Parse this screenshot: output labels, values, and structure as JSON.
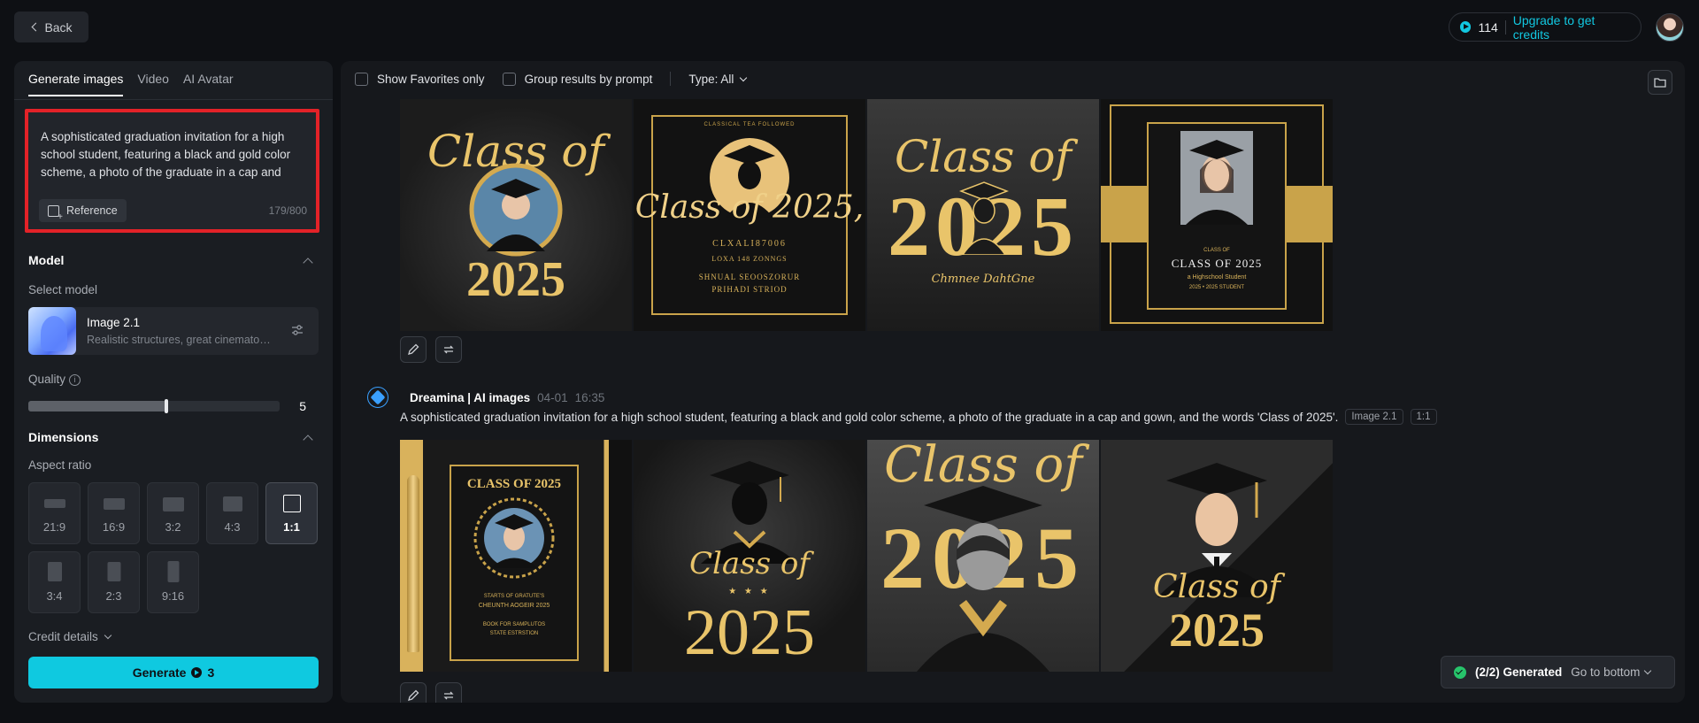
{
  "topbar": {
    "back_label": "Back",
    "credits": "114",
    "upgrade_label": "Upgrade to get credits"
  },
  "left": {
    "tabs": [
      {
        "label": "Generate images"
      },
      {
        "label": "Video"
      },
      {
        "label": "AI Avatar"
      }
    ],
    "prompt": "A sophisticated graduation invitation for a high school student, featuring a black and gold color scheme, a photo of the graduate in a cap and gown, and the words 'Class of 2025'.",
    "reference_label": "Reference",
    "char_count": "179/800",
    "model_section": "Model",
    "select_model_label": "Select model",
    "model_name": "Image 2.1",
    "model_desc": "Realistic structures, great cinematography",
    "quality_label": "Quality",
    "quality_value": "5",
    "quality_fraction": 0.55,
    "dimensions_section": "Dimensions",
    "aspect_label": "Aspect ratio",
    "ratios": [
      {
        "label": "21:9"
      },
      {
        "label": "16:9"
      },
      {
        "label": "3:2"
      },
      {
        "label": "4:3"
      },
      {
        "label": "1:1"
      },
      {
        "label": "3:4"
      },
      {
        "label": "2:3"
      },
      {
        "label": "9:16"
      }
    ],
    "selected_ratio": "1:1",
    "credit_details_label": "Credit details",
    "generate_label": "Generate",
    "generate_cost": "3"
  },
  "main": {
    "filters": {
      "favorites_label": "Show Favorites only",
      "group_label": "Group results by prompt",
      "type_label": "Type: All"
    },
    "row1": {
      "tile1": {
        "line1": "Class of",
        "line2": "2025"
      },
      "tile2": {
        "line1": "Class of 2025,",
        "line2": "CLXALI87006",
        "line3": "LOXA 148 ZONNGS",
        "line4": "SHNUAL SEOOSZORUR",
        "line5": "PRIHADI STRIOD",
        "top": "CLASSICAL TEA FOLLOWED"
      },
      "tile3": {
        "line1": "Class of",
        "line2": "2025",
        "line3": "Chmnee DahtGne"
      },
      "tile4": {
        "line1": "CLASS OF 2025",
        "line2": "CLASS OF",
        "line3": "a Highschool Student",
        "line4": "2025 • 2025 STUDENT"
      }
    },
    "gen": {
      "source": "Dreamina | AI images",
      "date": "04-01",
      "time": "16:35",
      "prompt": "A sophisticated graduation invitation for a high school student, featuring a black and gold color scheme, a photo of the graduate in a cap and gown, and the words 'Class of 2025'.",
      "model_tag": "Image 2.1",
      "ratio_tag": "1:1"
    },
    "row2": {
      "tile1": {
        "line1": "CLASS OF 2025",
        "line2": "STARTS OF GRATUTE'S",
        "line3": "CHEUNTH AOGEIR 2025",
        "line4": "BOOK FOR SAMPLUTOS",
        "line5": "STATE ESTRSTION"
      },
      "tile2": {
        "line1": "Class of",
        "line2": "2025",
        "stars": "★ ★ ★"
      },
      "tile3": {
        "line1": "Class of",
        "line2": "2025"
      },
      "tile4": {
        "line1": "Class of",
        "line2": "2025"
      }
    },
    "toast": {
      "status": "(2/2) Generated",
      "link": "Go to bottom"
    }
  },
  "colors": {
    "accent": "#0fc9e0",
    "highlight_border": "#e32228",
    "gold": "#e9c46a"
  }
}
